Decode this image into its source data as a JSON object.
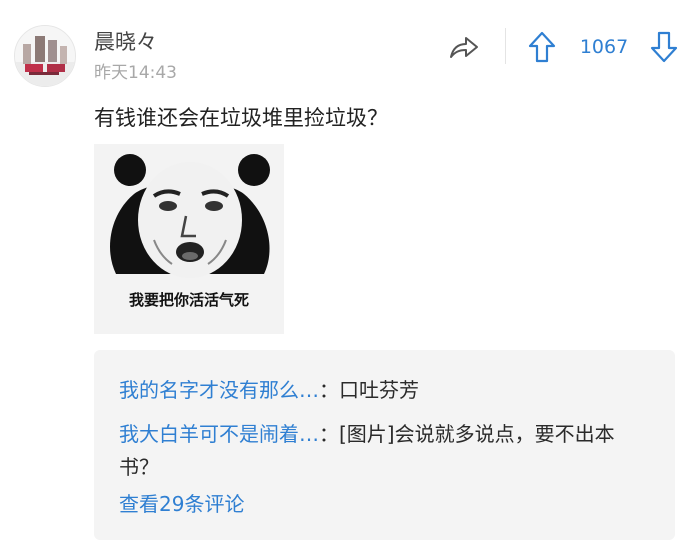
{
  "comment": {
    "username": "晨晓々",
    "timestamp": "昨天14:43",
    "text": "有钱谁还会在垃圾堆里捡垃圾？",
    "vote_count": "1067",
    "icons": {
      "share": "share-icon",
      "upvote": "arrow-up-icon",
      "downvote": "arrow-down-icon"
    },
    "meme": {
      "caption": "我要把你活活气死"
    }
  },
  "replies": {
    "items": [
      {
        "author": "我的名字才没有那么…",
        "separator": "：",
        "text": "口吐芬芳"
      },
      {
        "author": "我大白羊可不是闹着…",
        "separator": "：",
        "text": "[图片]会说就多说点，要不出本书？"
      }
    ],
    "view_all": "查看29条评论"
  },
  "colors": {
    "accent": "#2f7fd2",
    "reply_background": "#f4f4f4",
    "secondary_text": "#a8a8a8"
  }
}
